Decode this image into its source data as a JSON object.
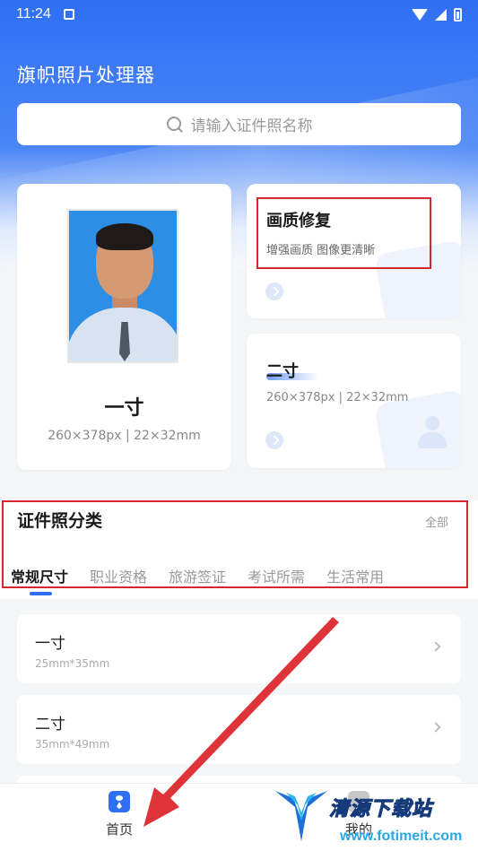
{
  "status_bar": {
    "time": "11:24"
  },
  "app": {
    "title": "旗帜照片处理器"
  },
  "search": {
    "placeholder": "请输入证件照名称"
  },
  "feature_cards": {
    "one_inch": {
      "title": "一寸",
      "spec": "260×378px | 22×32mm"
    },
    "repair": {
      "title": "画质修复",
      "desc": "增强画质 图像更清晰"
    },
    "two_inch": {
      "title": "二寸",
      "spec": "260×378px | 22×32mm"
    }
  },
  "category": {
    "title": "证件照分类",
    "all_label": "全部",
    "tabs": [
      "常规尺寸",
      "职业资格",
      "旅游签证",
      "考试所需",
      "生活常用"
    ],
    "active_tab": 0
  },
  "list": [
    {
      "name": "一寸",
      "size": "25mm*35mm"
    },
    {
      "name": "二寸",
      "size": "35mm*49mm"
    }
  ],
  "bottom_nav": {
    "home": "首页",
    "mine": "我的"
  },
  "watermark": {
    "site_name": "清源下载站",
    "url": "www.fotimeit.com"
  },
  "colors": {
    "primary": "#2f6ff4",
    "highlight": "#d7262f"
  }
}
